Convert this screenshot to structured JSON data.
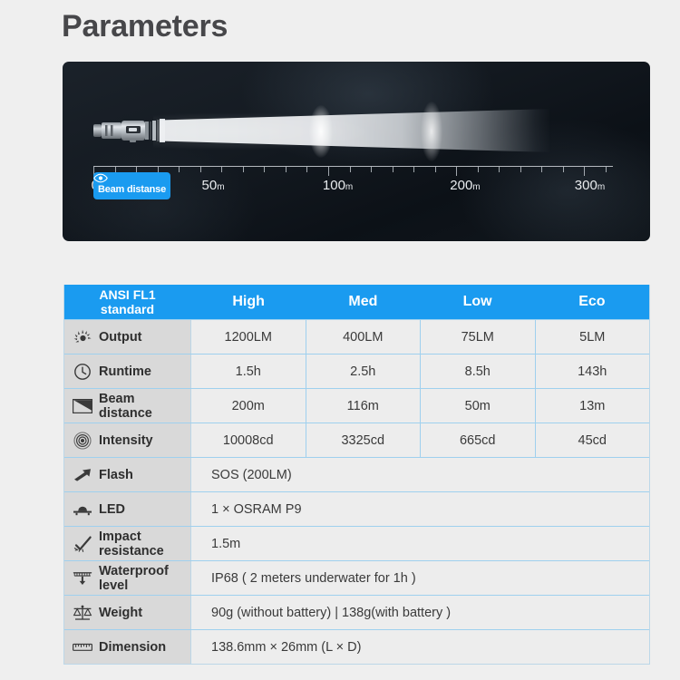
{
  "page_title": "Parameters",
  "hero": {
    "badge": {
      "label": "Beam distanse",
      "icon": "eye-icon",
      "color": "#1a9bf0"
    },
    "axis": {
      "labels": [
        {
          "value": "0",
          "unit": "m",
          "pos_pct": 0.0
        },
        {
          "value": "50",
          "unit": "m",
          "pos_pct": 22.0
        },
        {
          "value": "100",
          "unit": "m",
          "pos_pct": 46.0
        },
        {
          "value": "200",
          "unit": "m",
          "pos_pct": 70.5
        },
        {
          "value": "300",
          "unit": "m",
          "pos_pct": 94.5
        }
      ]
    },
    "illustration": "flashlight-beam-cone"
  },
  "table": {
    "header": {
      "standard_label": "ANSI FL1\nstandard",
      "standard_line1": "ANSI FL1",
      "standard_line2": "standard",
      "modes": [
        "High",
        "Med",
        "Low",
        "Eco"
      ]
    },
    "rows": [
      {
        "icon": "sun-burst-icon",
        "label": "Output",
        "label_line1": "Output",
        "label_line2": "",
        "values": [
          "1200LM",
          "400LM",
          "75LM",
          "5LM"
        ]
      },
      {
        "icon": "clock-icon",
        "label": "Runtime",
        "label_line1": "Runtime",
        "label_line2": "",
        "values": [
          "1.5h",
          "2.5h",
          "8.5h",
          "143h"
        ]
      },
      {
        "icon": "beam-cone-icon",
        "label": "Beam distance",
        "label_line1": "Beam",
        "label_line2": "distance",
        "values": [
          "200m",
          "116m",
          "50m",
          "13m"
        ]
      },
      {
        "icon": "target-rings-icon",
        "label": "Intensity",
        "label_line1": "Intensity",
        "label_line2": "",
        "values": [
          "10008cd",
          "3325cd",
          "665cd",
          "45cd"
        ]
      }
    ],
    "spanned_rows": [
      {
        "icon": "lightning-flash-icon",
        "label": "Flash",
        "label_line1": "Flash",
        "label_line2": "",
        "value": "SOS (200LM)"
      },
      {
        "icon": "led-chip-icon",
        "label": "LED",
        "label_line1": "LED",
        "label_line2": "",
        "value": "1 × OSRAM P9"
      },
      {
        "icon": "impact-check-icon",
        "label": "Impact resistance",
        "label_line1": "Impact",
        "label_line2": "resistance",
        "value": "1.5m"
      },
      {
        "icon": "waterproof-icon",
        "label": "Waterproof level",
        "label_line1": "Waterproof",
        "label_line2": "level",
        "value": "IP68 ( 2 meters underwater for 1h )"
      },
      {
        "icon": "scale-balance-icon",
        "label": "Weight",
        "label_line1": "Weight",
        "label_line2": "",
        "value": "90g (without battery) | 138g(with battery )"
      },
      {
        "icon": "ruler-icon",
        "label": "Dimension",
        "label_line1": "Dimension",
        "label_line2": "",
        "value": "138.6mm × 26mm (L × D)"
      }
    ]
  },
  "colors": {
    "accent_blue": "#1a9bf0",
    "page_bg": "#efefef",
    "label_cell_bg": "#d9d9d9",
    "value_cell_bg": "#ededed",
    "grid_line": "#9fd0ee",
    "title_text": "#47474a"
  }
}
